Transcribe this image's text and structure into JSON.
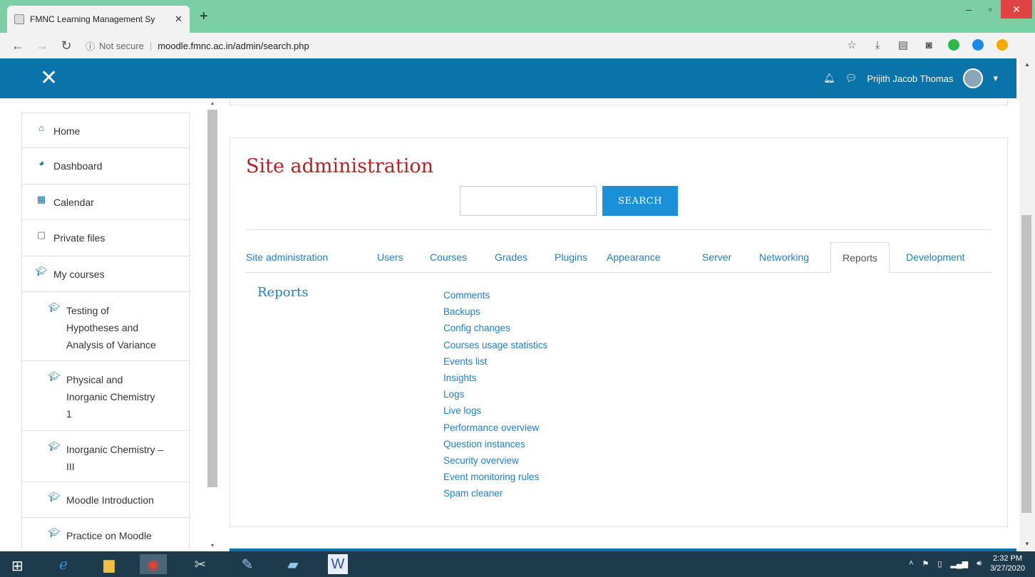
{
  "browser": {
    "tab_title": "FMNC Learning Management Sy",
    "new_tab": "+",
    "address_not_secure": "Not secure",
    "url": "moodle.fmnc.ac.in/admin/search.php"
  },
  "navbar": {
    "user_name": "Prijith Jacob Thomas"
  },
  "drawer": {
    "items": [
      {
        "label": "Home",
        "icon": "home-icon"
      },
      {
        "label": "Dashboard",
        "icon": "dashboard-icon"
      },
      {
        "label": "Calendar",
        "icon": "calendar-icon"
      },
      {
        "label": "Private files",
        "icon": "file-icon"
      },
      {
        "label": "My courses",
        "icon": "graduation-cap-icon"
      }
    ],
    "courses": [
      {
        "lines": [
          "Testing of",
          "Hypotheses and",
          "Analysis of Variance"
        ]
      },
      {
        "lines": [
          "Physical and",
          "Inorganic Chemistry",
          "1"
        ]
      },
      {
        "lines": [
          "Inorganic Chemistry –",
          "III"
        ]
      },
      {
        "lines": [
          "Moodle Introduction"
        ]
      },
      {
        "lines": [
          "Practice on Moodle"
        ]
      }
    ]
  },
  "main": {
    "title": "Site administration",
    "search_button": "SEARCH",
    "tabs": [
      "Site administration",
      "Users",
      "Courses",
      "Grades",
      "Plugins",
      "Appearance",
      "Server",
      "Networking",
      "Reports",
      "Development"
    ],
    "active_tab": "Reports",
    "section_heading": "Reports",
    "links": [
      "Comments",
      "Backups",
      "Config changes",
      "Courses usage statistics",
      "Events list",
      "Insights",
      "Logs",
      "Live logs",
      "Performance overview",
      "Question instances",
      "Security overview",
      "Event monitoring rules",
      "Spam cleaner"
    ]
  },
  "taskbar": {
    "time": "2:32 PM",
    "date": "3/27/2020"
  },
  "colors": {
    "navbar": "#0a73a9",
    "title": "#b22222",
    "link": "#1f7fc4",
    "search_button": "#1b8fd8"
  }
}
